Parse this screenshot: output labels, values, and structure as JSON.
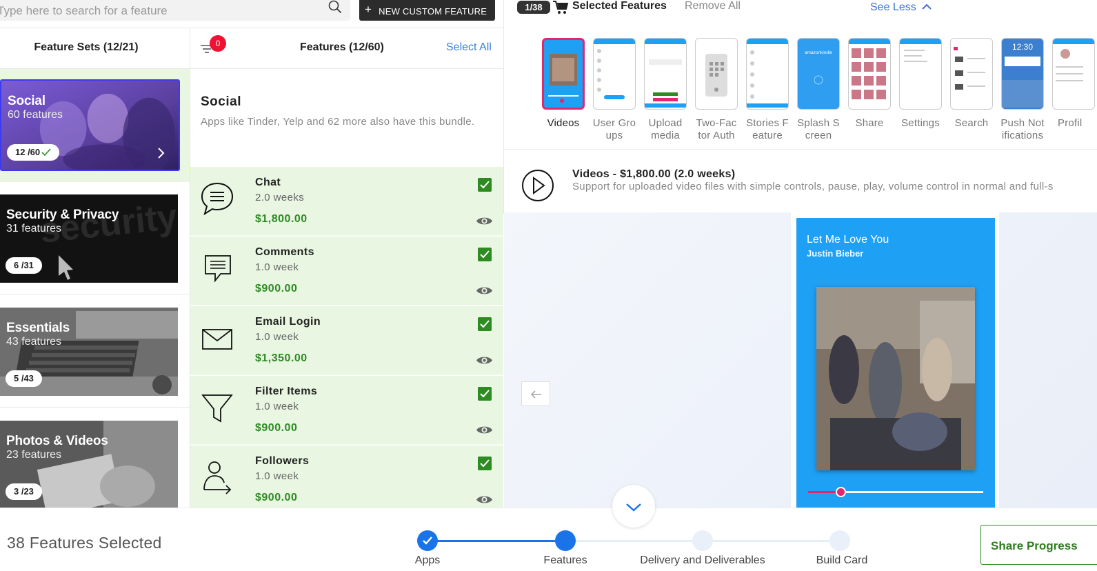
{
  "search": {
    "placeholder": "Type here to search for a feature"
  },
  "new_feature_label": "NEW CUSTOM FEATURE",
  "selected": {
    "badge": "1/38",
    "title": "Selected Features",
    "remove_all": "Remove All",
    "see_less": "See Less"
  },
  "left": {
    "feature_sets_title": "Feature Sets (12/21)",
    "filter_count": "0",
    "features_title": "Features (12/60)",
    "select_all": "Select All"
  },
  "feature_sets": [
    {
      "name": "Social",
      "count": "60 features",
      "progress": "12 /60",
      "complete": true
    },
    {
      "name": "Security & Privacy",
      "count": "31 features",
      "progress": "6 /31"
    },
    {
      "name": "Essentials",
      "count": "43 features",
      "progress": "5 /43"
    },
    {
      "name": "Photos & Videos",
      "count": "23 features",
      "progress": "3 /23"
    }
  ],
  "bundle": {
    "title": "Social",
    "description": "Apps like Tinder, Yelp and 62 more also have this bundle."
  },
  "features": [
    {
      "name": "Chat",
      "duration": "2.0 weeks",
      "price": "$1,800.00",
      "icon": "chat-bubble-icon",
      "checked": true
    },
    {
      "name": "Comments",
      "duration": "1.0 week",
      "price": "$900.00",
      "icon": "comment-icon",
      "checked": true
    },
    {
      "name": "Email Login",
      "duration": "1.0 week",
      "price": "$1,350.00",
      "icon": "envelope-icon",
      "checked": true
    },
    {
      "name": "Filter Items",
      "duration": "1.0 week",
      "price": "$900.00",
      "icon": "filter-funnel-icon",
      "checked": true
    },
    {
      "name": "Followers",
      "duration": "1.0 week",
      "price": "$900.00",
      "icon": "follower-icon",
      "checked": true
    }
  ],
  "thumbnails": [
    {
      "label": "Videos",
      "active": true
    },
    {
      "label": "User Gro ups"
    },
    {
      "label": "Upload media"
    },
    {
      "label": "Two-Fac tor Auth"
    },
    {
      "label": "Stories F eature"
    },
    {
      "label": "Splash S creen"
    },
    {
      "label": "Share"
    },
    {
      "label": "Settings"
    },
    {
      "label": "Search"
    },
    {
      "label": "Push Not ifications"
    },
    {
      "label": "Profil"
    }
  ],
  "thumb_texts": {
    "splash": "amazonkindle",
    "clock": "12:30"
  },
  "preview": {
    "title": "Videos - $1,800.00 (2.0 weeks)",
    "description": "Support for uploaded video files with simple controls, pause, play, volume control in normal and full-s",
    "song": "Let Me Love You",
    "artist": "Justin Bieber",
    "progress": 0.19
  },
  "bottom": {
    "features_selected": "38 Features Selected",
    "steps": [
      {
        "label": "Apps",
        "state": "done"
      },
      {
        "label": "Features",
        "state": "current"
      },
      {
        "label": "Delivery and Deliverables",
        "state": "todo"
      },
      {
        "label": "Build Card",
        "state": "todo"
      }
    ],
    "share": "Share Progress"
  },
  "colors": {
    "accent_blue": "#1a73e8",
    "green": "#2e8b22",
    "pink": "#e4266a",
    "feature_bg": "#e8f6e2",
    "phone_blue": "#1ea0f5"
  }
}
